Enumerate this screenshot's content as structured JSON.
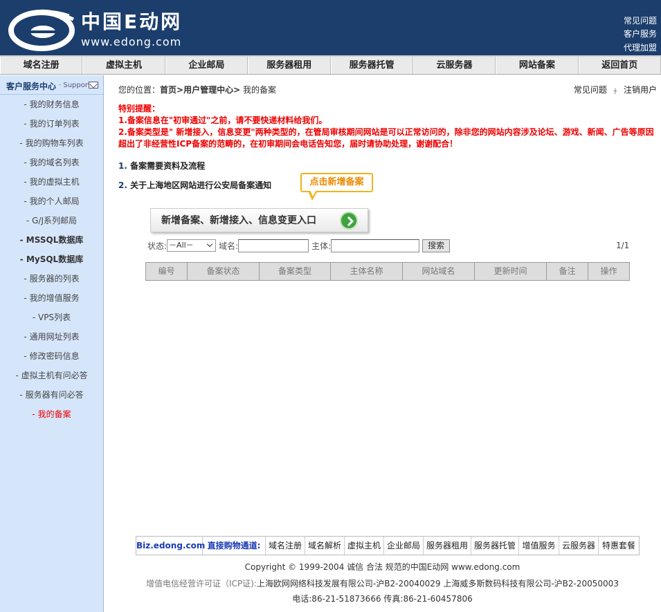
{
  "header": {
    "logo_cn": "中国E动网",
    "logo_url": "www.edong.com",
    "links": [
      "常见问题",
      "客户服务",
      "代理加盟"
    ]
  },
  "nav": [
    "域名注册",
    "虚拟主机",
    "企业邮局",
    "服务器租用",
    "服务器托管",
    "云服务器",
    "网站备案",
    "返回首页"
  ],
  "sidebar": {
    "title": "客户服务中心",
    "support": "· Support",
    "items": [
      {
        "label": "- 我的财务信息",
        "style": "normal"
      },
      {
        "label": "- 我的订单列表",
        "style": "normal"
      },
      {
        "label": "- 我的购物车列表",
        "style": "normal"
      },
      {
        "label": "- 我的域名列表",
        "style": "normal"
      },
      {
        "label": "- 我的虚拟主机",
        "style": "normal"
      },
      {
        "label": "- 我的个人邮局",
        "style": "normal"
      },
      {
        "label": "- G/J系列邮局",
        "style": "normal"
      },
      {
        "label": "- MSSQL数据库",
        "style": "bold"
      },
      {
        "label": "- MySQL数据库",
        "style": "bold"
      },
      {
        "label": "- 服务器的列表",
        "style": "normal"
      },
      {
        "label": "- 我的增值服务",
        "style": "normal"
      },
      {
        "label": "- VPS列表",
        "style": "normal"
      },
      {
        "label": "- 通用网址列表",
        "style": "normal"
      },
      {
        "label": "- 修改密码信息",
        "style": "normal"
      },
      {
        "label": "- 虚拟主机有问必答",
        "style": "normal"
      },
      {
        "label": "- 服务器有问必答",
        "style": "normal"
      },
      {
        "label": "- 我的备案",
        "style": "active"
      }
    ]
  },
  "breadcrumb": {
    "prefix": "您的位置：",
    "path": "首页>用户管理中心>",
    "current": " 我的备案"
  },
  "toplinks": {
    "faq": "常见问题",
    "sep": "ǂ",
    "logout": "注销用户"
  },
  "notice": {
    "title": "特别提醒：",
    "line1": "1.备案信息在\"初审通过\"之前，请不要快递材料给我们。",
    "line2": "2.备案类型是\" 新增接入，信息变更\"两种类型的，在管局审核期间网站是可以正常访问的，除非您的网站内容涉及论坛、游戏、新闻、广告等原因超出了非经营性ICP备案的范畴的，在初审期间会电话告知您，届时请协助处理，谢谢配合！"
  },
  "guides": [
    {
      "num": "1.",
      "text": "备案需要资料及流程"
    },
    {
      "num": "2.",
      "text": "关于上海地区网站进行公安局备案通知"
    }
  ],
  "bubble": "点击新增备案",
  "big_button": "新增备案、新增接入、信息变更入口",
  "filters": {
    "status_label": "状态:",
    "status_value": "－All－",
    "domain_label": "域名:",
    "domain_value": "",
    "subject_label": "主体:",
    "subject_value": "",
    "search_label": "搜索"
  },
  "pager": "1/1",
  "table_headers": [
    "编号",
    "备案状态",
    "备案类型",
    "主体名称",
    "网站域名",
    "更新时间",
    "备注",
    "操作"
  ],
  "footer_nav": [
    "Biz.edong.com",
    "直接购物通道:",
    "域名注册",
    "域名解析",
    "虚拟主机",
    "企业邮局",
    "服务器租用",
    "服务器托管",
    "增值服务",
    "云服务器",
    "特惠套餐"
  ],
  "footer": {
    "copyright": "Copyright © 1999-2004 诚信 合法 规范的中国E动网 www.edong.com",
    "icp_label": "增值电信经营许可证（ICP证):",
    "icp_text": "上海欧网网络科技发展有限公司-沪B2-20040029 上海威多斯数码科技有限公司-沪B2-20050003",
    "contact": "电话:86-21-51873666 传真:86-21-60457806"
  }
}
